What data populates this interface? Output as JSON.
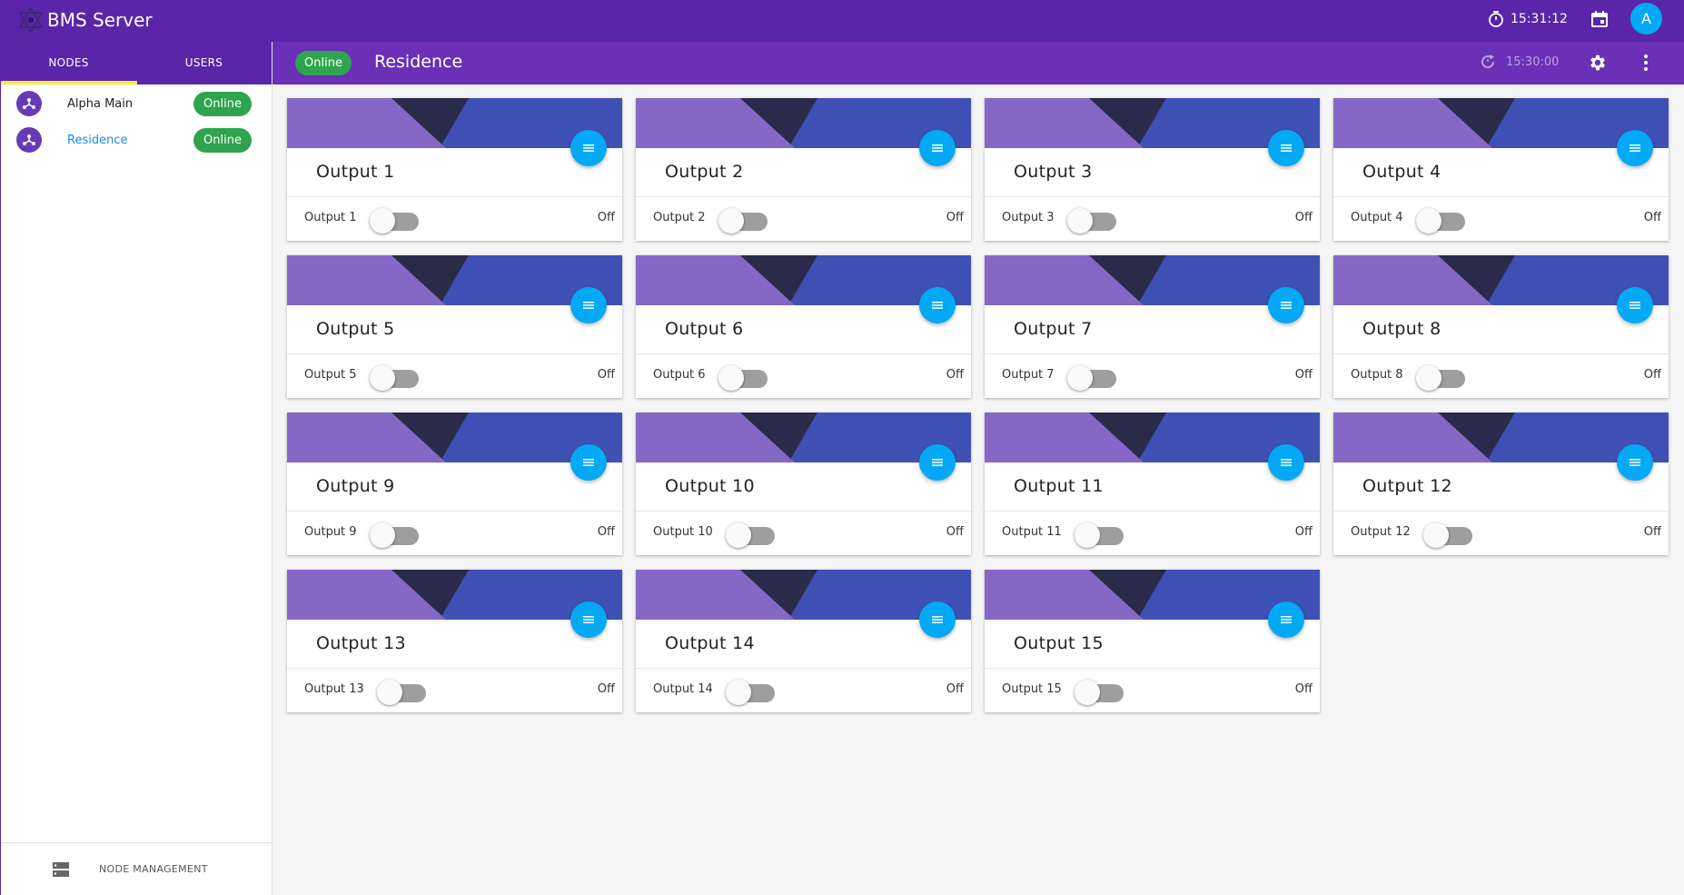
{
  "app": {
    "title": "BMS Server",
    "clock": "15:31:12",
    "avatar": "A"
  },
  "sidebar": {
    "tabs": [
      "NODES",
      "USERS"
    ],
    "nodes": [
      {
        "name": "Alpha Main",
        "status": "Online",
        "active": false
      },
      {
        "name": "Residence",
        "status": "Online",
        "active": true
      }
    ],
    "footer_label": "NODE MANAGEMENT"
  },
  "subbar": {
    "status": "Online",
    "title": "Residence",
    "time": "15:30:00"
  },
  "colors": {
    "appbar": "#5a25a9",
    "subbar": "#6b2fb8",
    "online": "#2ea44f",
    "fab": "#03a9f4",
    "tab_indicator": "#ffeb3b"
  },
  "icons": [
    "logo-icon",
    "timer-icon",
    "calendar-icon",
    "node-icon",
    "server-icon",
    "refresh-icon",
    "gear-icon",
    "more-vert-icon",
    "list-icon"
  ],
  "cards": [
    {
      "title": "Output 1",
      "label": "Output 1",
      "state": "Off"
    },
    {
      "title": "Output 2",
      "label": "Output 2",
      "state": "Off"
    },
    {
      "title": "Output 3",
      "label": "Output 3",
      "state": "Off"
    },
    {
      "title": "Output 4",
      "label": "Output 4",
      "state": "Off"
    },
    {
      "title": "Output 5",
      "label": "Output 5",
      "state": "Off"
    },
    {
      "title": "Output 6",
      "label": "Output 6",
      "state": "Off"
    },
    {
      "title": "Output 7",
      "label": "Output 7",
      "state": "Off"
    },
    {
      "title": "Output 8",
      "label": "Output 8",
      "state": "Off"
    },
    {
      "title": "Output 9",
      "label": "Output 9",
      "state": "Off"
    },
    {
      "title": "Output 10",
      "label": "Output 10",
      "state": "Off"
    },
    {
      "title": "Output 11",
      "label": "Output 11",
      "state": "Off"
    },
    {
      "title": "Output 12",
      "label": "Output 12",
      "state": "Off"
    },
    {
      "title": "Output 13",
      "label": "Output 13",
      "state": "Off"
    },
    {
      "title": "Output 14",
      "label": "Output 14",
      "state": "Off"
    },
    {
      "title": "Output 15",
      "label": "Output 15",
      "state": "Off"
    }
  ]
}
